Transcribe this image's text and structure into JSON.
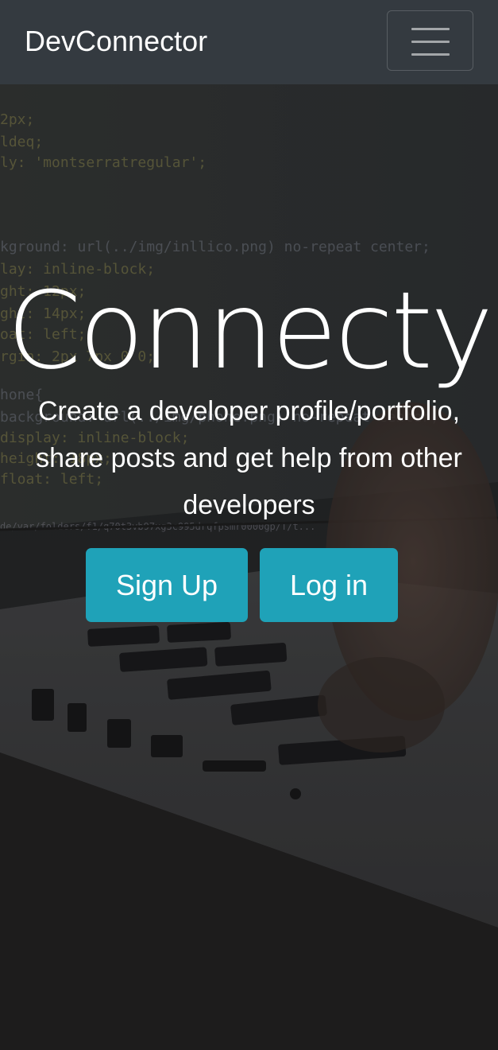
{
  "navbar": {
    "brand": "DevConnector",
    "toggler_icon": "hamburger-menu-icon"
  },
  "hero": {
    "title": "Connecty",
    "lead": "Create a developer profile/portfolio, share posts and get help from other developers",
    "signup_label": "Sign Up",
    "login_label": "Log in",
    "background_image": "laptop-code-photo"
  },
  "colors": {
    "navbar_bg": "#343a40",
    "button_bg": "#1fa2b8",
    "text": "#ffffff"
  }
}
